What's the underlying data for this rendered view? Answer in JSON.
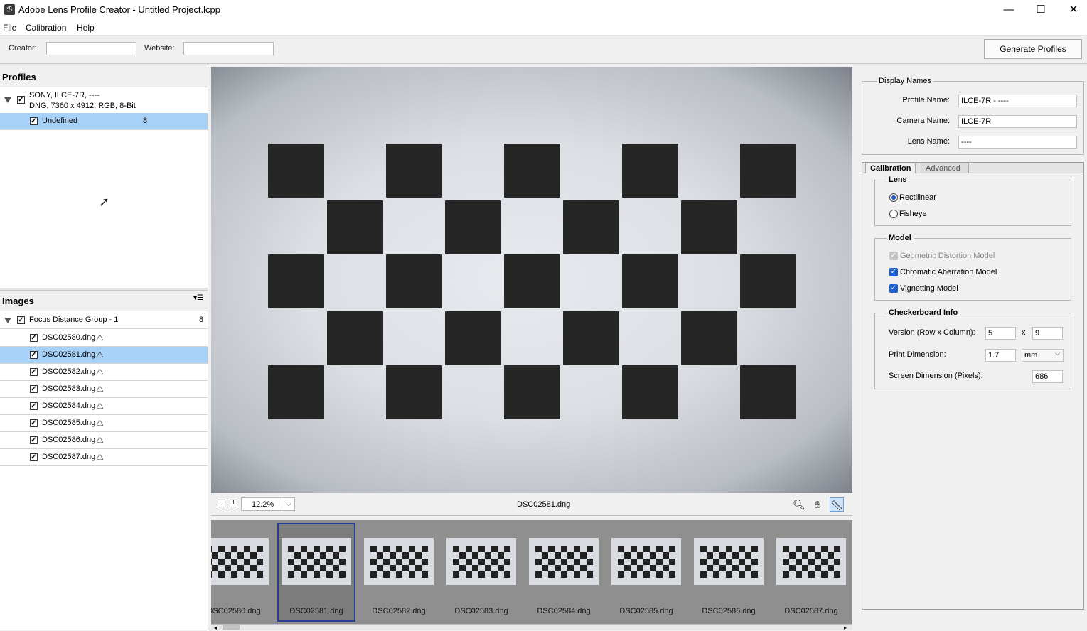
{
  "window": {
    "title": "Adobe Lens Profile Creator - Untitled Project.lcpp",
    "icon_label": "ℬ",
    "minimize_glyph": "—",
    "maximize_glyph": "☐",
    "close_glyph": "✕"
  },
  "menu": [
    "File",
    "Calibration",
    "Help"
  ],
  "toolbar": {
    "creator_label": "Creator:",
    "creator_value": "",
    "website_label": "Website:",
    "website_value": "",
    "generate_label": "Generate Profiles"
  },
  "profiles": {
    "heading": "Profiles",
    "camera_line1": "SONY, ILCE-7R, ----",
    "camera_line2": "DNG, 7360 x 4912, RGB, 8-Bit",
    "item_label": "Undefined",
    "item_count": "8"
  },
  "images": {
    "heading": "Images",
    "group_label": "Focus Distance Group - 1",
    "group_count": "8",
    "files": [
      "DSC02580.dng",
      "DSC02581.dng",
      "DSC02582.dng",
      "DSC02583.dng",
      "DSC02584.dng",
      "DSC02585.dng",
      "DSC02586.dng",
      "DSC02587.dng"
    ],
    "selected_index": 1,
    "warning_glyph": "⚠"
  },
  "viewer": {
    "zoom": "12.2%",
    "filename": "DSC02581.dng"
  },
  "filmstrip": {
    "labels": [
      "DSC02580.dng",
      "DSC02581.dng",
      "DSC02582.dng",
      "DSC02583.dng",
      "DSC02584.dng",
      "DSC02585.dng",
      "DSC02586.dng",
      "DSC02587.dng"
    ],
    "selected_index": 1
  },
  "display_names": {
    "group_title": "Display Names",
    "profile_label": "Profile Name:",
    "profile_value": "ILCE-7R - ----",
    "camera_label": "Camera Name:",
    "camera_value": "ILCE-7R",
    "lens_label": "Lens Name:",
    "lens_value": "----"
  },
  "tabs": [
    "Calibration",
    "Advanced"
  ],
  "active_tab": "Calibration",
  "lens": {
    "group_title": "Lens",
    "options": [
      "Rectilinear",
      "Fisheye"
    ],
    "selected": "Rectilinear"
  },
  "model": {
    "group_title": "Model",
    "geometric": "Geometric Distortion Model",
    "chromatic": "Chromatic Aberration Model",
    "vignetting": "Vignetting Model"
  },
  "checkerboard": {
    "group_title": "Checkerboard Info",
    "version_label": "Version (Row x Column):",
    "rows": "5",
    "x_label": "x",
    "cols": "9",
    "print_label": "Print Dimension:",
    "print_value": "1.7",
    "print_unit": "mm",
    "screen_label": "Screen Dimension (Pixels):",
    "screen_value": "686"
  },
  "colors": {
    "selection": "#a8d1f7",
    "checkbox_blue": "#1b5fd0",
    "filmstrip_bg": "#8f8f8f"
  }
}
